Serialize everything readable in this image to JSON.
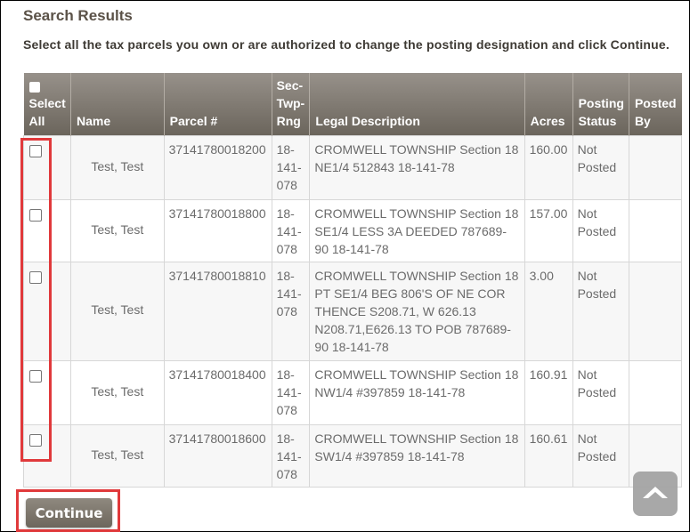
{
  "page": {
    "title": "Search Results",
    "instructions": "Select all the tax parcels you own or are authorized to change the posting designation and click Continue."
  },
  "table": {
    "headers": {
      "select_all": "Select All",
      "name": "Name",
      "parcel": "Parcel #",
      "sec_twp_rng": "Sec-Twp-Rng",
      "legal": "Legal Description",
      "acres": "Acres",
      "posting_status": "Posting Status",
      "posted_by": "Posted By"
    },
    "select_all_checked": false,
    "rows": [
      {
        "checked": false,
        "name": "Test, Test",
        "parcel": "37141780018200",
        "sec_twp_rng": "18-141-078",
        "legal": "CROMWELL TOWNSHIP Section 18 NE1/4 512843 18-141-78",
        "acres": "160.00",
        "status": "Not Posted",
        "posted_by": ""
      },
      {
        "checked": false,
        "name": "Test, Test",
        "parcel": "37141780018800",
        "sec_twp_rng": "18-141-078",
        "legal": "CROMWELL TOWNSHIP Section 18 SE1/4 LESS 3A DEEDED 787689-90 18-141-78",
        "acres": "157.00",
        "status": "Not Posted",
        "posted_by": ""
      },
      {
        "checked": false,
        "name": "Test, Test",
        "parcel": "37141780018810",
        "sec_twp_rng": "18-141-078",
        "legal": "CROMWELL TOWNSHIP Section 18 PT SE1/4 BEG 806'S OF NE COR THENCE S208.71, W 626.13 N208.71,E626.13 TO POB 787689-90 18-141-78",
        "acres": "3.00",
        "status": "Not Posted",
        "posted_by": ""
      },
      {
        "checked": false,
        "name": "Test, Test",
        "parcel": "37141780018400",
        "sec_twp_rng": "18-141-078",
        "legal": "CROMWELL TOWNSHIP Section 18 NW1/4 #397859 18-141-78",
        "acres": "160.91",
        "status": "Not Posted",
        "posted_by": ""
      },
      {
        "checked": false,
        "name": "Test, Test",
        "parcel": "37141780018600",
        "sec_twp_rng": "18-141-078",
        "legal": "CROMWELL TOWNSHIP Section 18 SW1/4 #397859 18-141-78",
        "acres": "160.61",
        "status": "Not Posted",
        "posted_by": ""
      }
    ]
  },
  "actions": {
    "continue_label": "Continue",
    "scroll_top_icon": "chevron-up-icon"
  },
  "colors": {
    "header_gradient_top": "#97918a",
    "header_gradient_bottom": "#6b655c",
    "highlight_red": "#e0393b",
    "title_brown": "#5b5248"
  }
}
